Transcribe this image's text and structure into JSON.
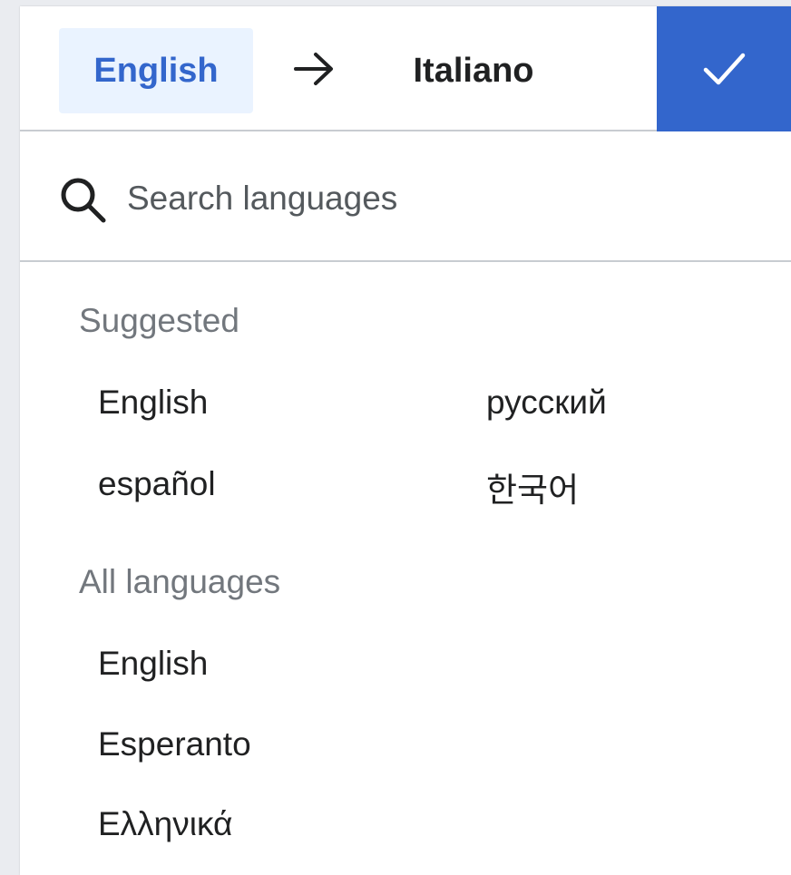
{
  "header": {
    "source_language": "English",
    "target_language": "Italiano",
    "arrow_icon": "arrow-right-icon",
    "done_icon": "checkmark-icon",
    "accent_color": "#3366cc"
  },
  "search": {
    "placeholder": "Search languages",
    "value": "",
    "icon": "search-icon"
  },
  "suggested": {
    "title": "Suggested",
    "languages": [
      "English",
      "español",
      "русский",
      "한국어"
    ]
  },
  "all_languages": {
    "title": "All languages",
    "languages": [
      "English",
      "Esperanto",
      "Ελληνικά"
    ]
  }
}
